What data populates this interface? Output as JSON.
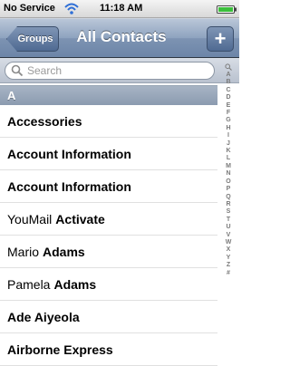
{
  "status_bar": {
    "carrier": "No Service",
    "time": "11:18 AM",
    "wifi_icon": "wifi-icon",
    "battery_icon": "battery-icon"
  },
  "nav": {
    "back_label": "Groups",
    "title": "All Contacts",
    "add_label": "+"
  },
  "search": {
    "placeholder": "Search",
    "value": ""
  },
  "section": {
    "header": "A"
  },
  "contacts": [
    {
      "first": "",
      "last": "Accessories"
    },
    {
      "first": "",
      "last": "Account Information"
    },
    {
      "first": "",
      "last": "Account Information"
    },
    {
      "first": "YouMail",
      "last": "Activate"
    },
    {
      "first": "Mario",
      "last": "Adams"
    },
    {
      "first": "Pamela",
      "last": "Adams"
    },
    {
      "first": "",
      "last": "Ade Aiyeola"
    },
    {
      "first": "",
      "last": "Airborne Express"
    }
  ],
  "index_letters": [
    "A",
    "B",
    "C",
    "D",
    "E",
    "F",
    "G",
    "H",
    "I",
    "J",
    "K",
    "L",
    "M",
    "N",
    "O",
    "P",
    "Q",
    "R",
    "S",
    "T",
    "U",
    "V",
    "W",
    "X",
    "Y",
    "Z",
    "#"
  ],
  "colors": {
    "nav_accent": "#6c85a8",
    "section_header": "#8b9bb0"
  }
}
